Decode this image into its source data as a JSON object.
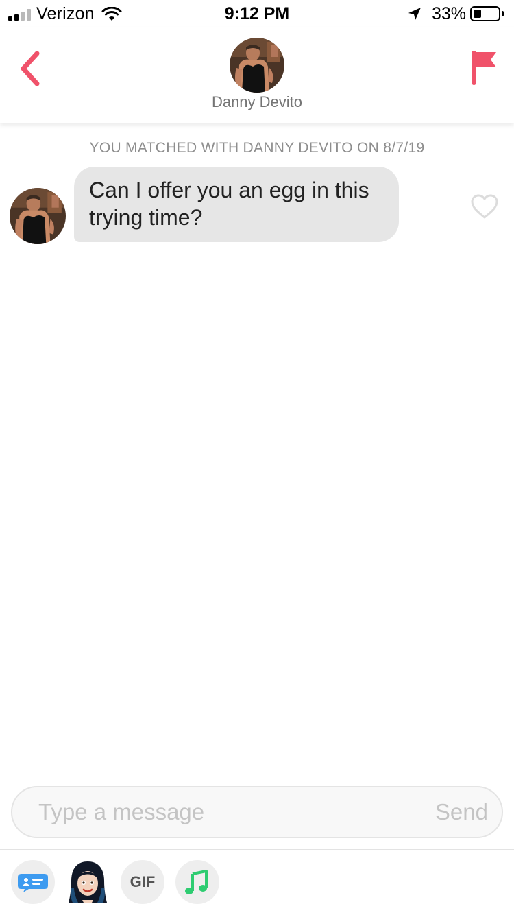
{
  "status_bar": {
    "carrier": "Verizon",
    "time": "9:12 PM",
    "battery_percent": "33%",
    "battery_level": 0.33,
    "signal_bars_filled": 2,
    "signal_bars_total": 4
  },
  "header": {
    "back_icon": "chevron-left-icon",
    "contact_name": "Danny Devito",
    "report_icon": "flag-icon",
    "accent_color": "#f0526a"
  },
  "chat": {
    "match_banner": "YOU MATCHED WITH DANNY DEVITO ON 8/7/19",
    "messages": [
      {
        "sender": "Danny Devito",
        "text": "Can I offer you an egg in this trying time?",
        "liked": false
      }
    ]
  },
  "composer": {
    "placeholder": "Type a message",
    "value": "",
    "send_label": "Send"
  },
  "toolbar": {
    "items": [
      {
        "icon": "chat-bubble-icon",
        "color": "#3d9bf0"
      },
      {
        "icon": "bitmoji-icon"
      },
      {
        "label": "GIF",
        "icon": "gif-icon"
      },
      {
        "icon": "music-note-icon",
        "color": "#2ecc71"
      }
    ]
  }
}
